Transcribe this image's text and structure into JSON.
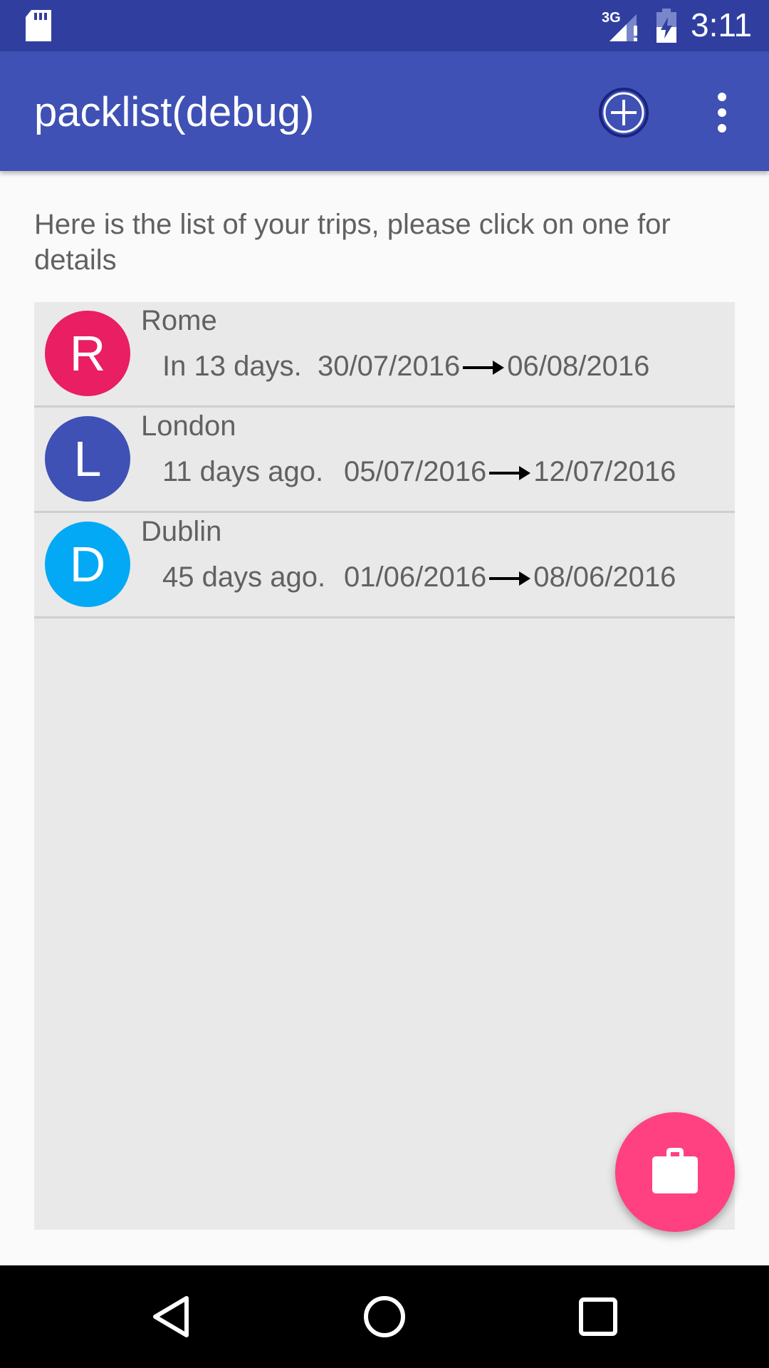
{
  "status_bar": {
    "network": "3G",
    "time": "3:11"
  },
  "app_bar": {
    "title": "packlist(debug)",
    "add_icon": "add-circle-icon",
    "more_icon": "more-vert-icon"
  },
  "intro_text": "Here is the list of your trips, please click on one for details",
  "trips": [
    {
      "initial": "R",
      "name": "Rome",
      "relative": "In 13 days.",
      "start": "30/07/2016",
      "end": "06/08/2016",
      "color": "#e91e63"
    },
    {
      "initial": "L",
      "name": "London",
      "relative": "11 days ago.",
      "start": "05/07/2016",
      "end": "12/07/2016",
      "color": "#3f51b5"
    },
    {
      "initial": "D",
      "name": "Dublin",
      "relative": "45 days ago.",
      "start": "01/06/2016",
      "end": "08/06/2016",
      "color": "#03a9f4"
    }
  ],
  "fab": {
    "icon": "briefcase-icon",
    "color": "#ff4081"
  },
  "nav": {
    "back_icon": "back-icon",
    "home_icon": "home-icon",
    "recents_icon": "recents-icon"
  },
  "colors": {
    "primary": "#3f51b5",
    "primary_dark": "#303f9f",
    "accent": "#ff4081"
  }
}
